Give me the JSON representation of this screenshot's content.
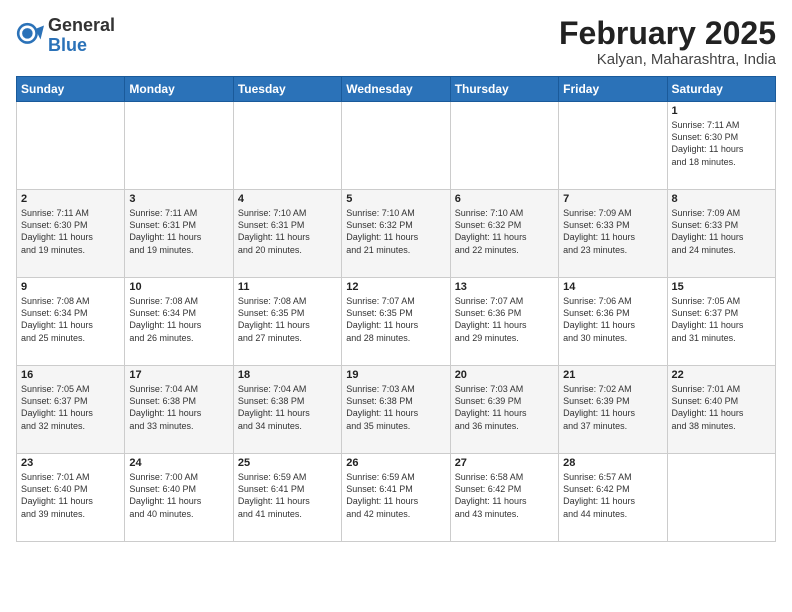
{
  "header": {
    "logo_general": "General",
    "logo_blue": "Blue",
    "month_title": "February 2025",
    "subtitle": "Kalyan, Maharashtra, India"
  },
  "days_of_week": [
    "Sunday",
    "Monday",
    "Tuesday",
    "Wednesday",
    "Thursday",
    "Friday",
    "Saturday"
  ],
  "weeks": [
    [
      {
        "day": "",
        "info": ""
      },
      {
        "day": "",
        "info": ""
      },
      {
        "day": "",
        "info": ""
      },
      {
        "day": "",
        "info": ""
      },
      {
        "day": "",
        "info": ""
      },
      {
        "day": "",
        "info": ""
      },
      {
        "day": "1",
        "info": "Sunrise: 7:11 AM\nSunset: 6:30 PM\nDaylight: 11 hours\nand 18 minutes."
      }
    ],
    [
      {
        "day": "2",
        "info": "Sunrise: 7:11 AM\nSunset: 6:30 PM\nDaylight: 11 hours\nand 19 minutes."
      },
      {
        "day": "3",
        "info": "Sunrise: 7:11 AM\nSunset: 6:31 PM\nDaylight: 11 hours\nand 19 minutes."
      },
      {
        "day": "4",
        "info": "Sunrise: 7:10 AM\nSunset: 6:31 PM\nDaylight: 11 hours\nand 20 minutes."
      },
      {
        "day": "5",
        "info": "Sunrise: 7:10 AM\nSunset: 6:32 PM\nDaylight: 11 hours\nand 21 minutes."
      },
      {
        "day": "6",
        "info": "Sunrise: 7:10 AM\nSunset: 6:32 PM\nDaylight: 11 hours\nand 22 minutes."
      },
      {
        "day": "7",
        "info": "Sunrise: 7:09 AM\nSunset: 6:33 PM\nDaylight: 11 hours\nand 23 minutes."
      },
      {
        "day": "8",
        "info": "Sunrise: 7:09 AM\nSunset: 6:33 PM\nDaylight: 11 hours\nand 24 minutes."
      }
    ],
    [
      {
        "day": "9",
        "info": "Sunrise: 7:08 AM\nSunset: 6:34 PM\nDaylight: 11 hours\nand 25 minutes."
      },
      {
        "day": "10",
        "info": "Sunrise: 7:08 AM\nSunset: 6:34 PM\nDaylight: 11 hours\nand 26 minutes."
      },
      {
        "day": "11",
        "info": "Sunrise: 7:08 AM\nSunset: 6:35 PM\nDaylight: 11 hours\nand 27 minutes."
      },
      {
        "day": "12",
        "info": "Sunrise: 7:07 AM\nSunset: 6:35 PM\nDaylight: 11 hours\nand 28 minutes."
      },
      {
        "day": "13",
        "info": "Sunrise: 7:07 AM\nSunset: 6:36 PM\nDaylight: 11 hours\nand 29 minutes."
      },
      {
        "day": "14",
        "info": "Sunrise: 7:06 AM\nSunset: 6:36 PM\nDaylight: 11 hours\nand 30 minutes."
      },
      {
        "day": "15",
        "info": "Sunrise: 7:05 AM\nSunset: 6:37 PM\nDaylight: 11 hours\nand 31 minutes."
      }
    ],
    [
      {
        "day": "16",
        "info": "Sunrise: 7:05 AM\nSunset: 6:37 PM\nDaylight: 11 hours\nand 32 minutes."
      },
      {
        "day": "17",
        "info": "Sunrise: 7:04 AM\nSunset: 6:38 PM\nDaylight: 11 hours\nand 33 minutes."
      },
      {
        "day": "18",
        "info": "Sunrise: 7:04 AM\nSunset: 6:38 PM\nDaylight: 11 hours\nand 34 minutes."
      },
      {
        "day": "19",
        "info": "Sunrise: 7:03 AM\nSunset: 6:38 PM\nDaylight: 11 hours\nand 35 minutes."
      },
      {
        "day": "20",
        "info": "Sunrise: 7:03 AM\nSunset: 6:39 PM\nDaylight: 11 hours\nand 36 minutes."
      },
      {
        "day": "21",
        "info": "Sunrise: 7:02 AM\nSunset: 6:39 PM\nDaylight: 11 hours\nand 37 minutes."
      },
      {
        "day": "22",
        "info": "Sunrise: 7:01 AM\nSunset: 6:40 PM\nDaylight: 11 hours\nand 38 minutes."
      }
    ],
    [
      {
        "day": "23",
        "info": "Sunrise: 7:01 AM\nSunset: 6:40 PM\nDaylight: 11 hours\nand 39 minutes."
      },
      {
        "day": "24",
        "info": "Sunrise: 7:00 AM\nSunset: 6:40 PM\nDaylight: 11 hours\nand 40 minutes."
      },
      {
        "day": "25",
        "info": "Sunrise: 6:59 AM\nSunset: 6:41 PM\nDaylight: 11 hours\nand 41 minutes."
      },
      {
        "day": "26",
        "info": "Sunrise: 6:59 AM\nSunset: 6:41 PM\nDaylight: 11 hours\nand 42 minutes."
      },
      {
        "day": "27",
        "info": "Sunrise: 6:58 AM\nSunset: 6:42 PM\nDaylight: 11 hours\nand 43 minutes."
      },
      {
        "day": "28",
        "info": "Sunrise: 6:57 AM\nSunset: 6:42 PM\nDaylight: 11 hours\nand 44 minutes."
      },
      {
        "day": "",
        "info": ""
      }
    ]
  ]
}
